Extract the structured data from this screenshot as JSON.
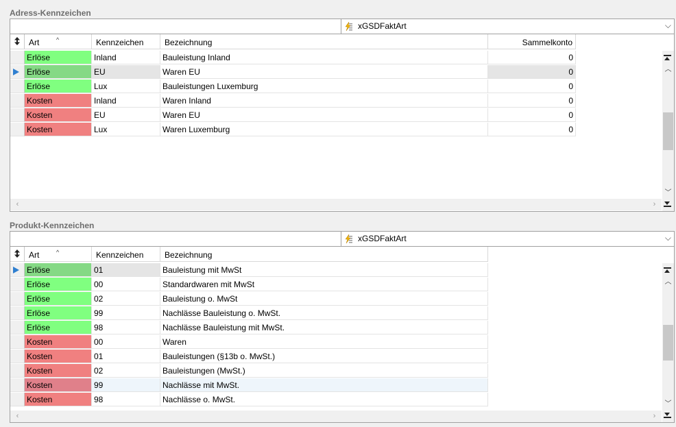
{
  "sections": [
    {
      "title": "Adress-Kennzeichen",
      "filter_label": "xGSDFaktArt",
      "columns": [
        "Art",
        "Kennzeichen",
        "Bezeichnung",
        "Sammelkonto"
      ],
      "rows": [
        {
          "art": "Erlöse",
          "kz": "Inland",
          "bez": "Bauleistung Inland",
          "sk": "0"
        },
        {
          "art": "Erlöse",
          "kz": "EU",
          "bez": "Waren EU",
          "sk": "0"
        },
        {
          "art": "Erlöse",
          "kz": "Lux",
          "bez": "Bauleistungen Luxemburg",
          "sk": "0"
        },
        {
          "art": "Kosten",
          "kz": "Inland",
          "bez": "Waren Inland",
          "sk": "0"
        },
        {
          "art": "Kosten",
          "kz": "EU",
          "bez": "Waren EU",
          "sk": "0"
        },
        {
          "art": "Kosten",
          "kz": "Lux",
          "bez": "Waren Luxemburg",
          "sk": "0"
        }
      ]
    },
    {
      "title": "Produkt-Kennzeichen",
      "filter_label": "xGSDFaktArt",
      "columns": [
        "Art",
        "Kennzeichen",
        "Bezeichnung"
      ],
      "rows": [
        {
          "art": "Erlöse",
          "kz": "01",
          "bez": "Bauleistung mit MwSt"
        },
        {
          "art": "Erlöse",
          "kz": "00",
          "bez": "Standardwaren mit MwSt"
        },
        {
          "art": "Erlöse",
          "kz": "02",
          "bez": "Bauleistung o. MwSt"
        },
        {
          "art": "Erlöse",
          "kz": "99",
          "bez": "Nachlässe Bauleistung o. MwSt."
        },
        {
          "art": "Erlöse",
          "kz": "98",
          "bez": "Nachlässe Bauleistung mit MwSt."
        },
        {
          "art": "Kosten",
          "kz": "00",
          "bez": "Waren"
        },
        {
          "art": "Kosten",
          "kz": "01",
          "bez": "Bauleistungen (§13b o. MwSt.)"
        },
        {
          "art": "Kosten",
          "kz": "02",
          "bez": "Bauleistungen (MwSt.)"
        },
        {
          "art": "Kosten",
          "kz": "99",
          "bez": "Nachlässe mit MwSt."
        },
        {
          "art": "Kosten",
          "kz": "98",
          "bez": "Nachlässe o.  MwSt."
        }
      ]
    }
  ],
  "colors": {
    "erloese": "#80ff80",
    "kosten": "#f08080",
    "pointer": "#2f7fd0"
  },
  "icons": [
    "sort-updown-icon",
    "filter-lightning-icon",
    "chevron-down-icon",
    "row-pointer-icon",
    "scroll-up-icon",
    "scroll-down-icon",
    "scroll-left-icon",
    "scroll-right-icon",
    "scroll-top-icon",
    "scroll-bottom-icon"
  ]
}
